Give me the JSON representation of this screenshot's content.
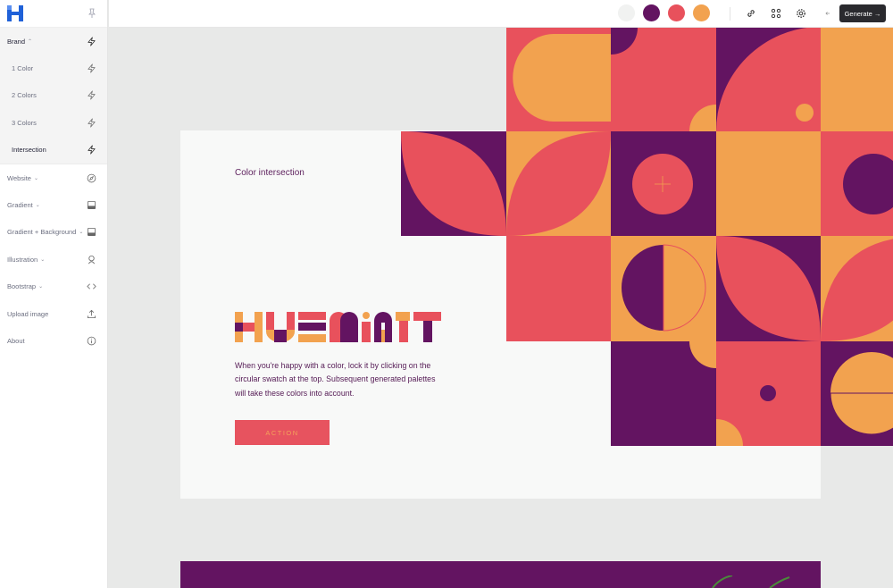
{
  "app": {
    "logo_text": "H"
  },
  "sidebar": {
    "items": [
      {
        "label": "Brand",
        "expanded": true,
        "icon": "bolt-icon"
      },
      {
        "label": "1 Color",
        "icon": "bolt-icon"
      },
      {
        "label": "2 Colors",
        "icon": "bolt-icon"
      },
      {
        "label": "3 Colors",
        "icon": "bolt-icon"
      },
      {
        "label": "Intersection",
        "icon": "bolt-icon",
        "active": true
      },
      {
        "label": "Website",
        "icon": "compass-icon"
      },
      {
        "label": "Gradient",
        "icon": "gradient-icon"
      },
      {
        "label": "Gradient + Background",
        "icon": "gradient-icon"
      },
      {
        "label": "Illustration",
        "icon": "illustration-icon"
      },
      {
        "label": "Bootstrap",
        "icon": "code-icon"
      },
      {
        "label": "Upload image",
        "icon": "upload-icon"
      },
      {
        "label": "About",
        "icon": "info-icon"
      }
    ]
  },
  "topbar": {
    "swatches": [
      "#f1f2f1",
      "#631461",
      "#e8515c",
      "#f2a24f"
    ],
    "generate_label": "Generate →"
  },
  "hero": {
    "title": "Color intersection",
    "wordmark": "HUEMINT",
    "description": "When you're happy with a color, lock it by clicking on the circular swatch at the top. Subsequent generated palettes will take these colors into account.",
    "action_label": "ACTION"
  },
  "colors": {
    "purple": "#631461",
    "coral": "#e8515c",
    "orange": "#f2a24f",
    "light": "#f8f9f8",
    "gray": "#e8e9e8",
    "accent": "#1b5fd6"
  }
}
